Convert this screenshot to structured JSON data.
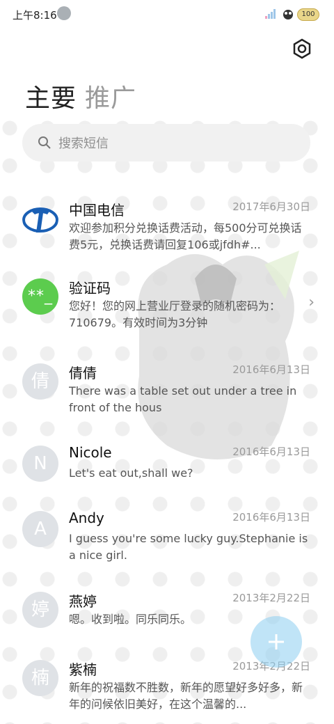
{
  "status_bar": {
    "time": "上午8:16",
    "battery": "100"
  },
  "tabs": [
    {
      "label": "主要",
      "active": true
    },
    {
      "label": "推广",
      "active": false
    }
  ],
  "search": {
    "placeholder": "搜索短信"
  },
  "conversations": [
    {
      "avatar": "telecom-logo",
      "name": "中国电信",
      "date": "2017年6月30日",
      "preview": "欢迎参加积分兑换话费活动，每500分可兑换话费5元，兑换话费请回复106或jfdh#..."
    },
    {
      "avatar_text": "**_",
      "name": "验证码",
      "date": "",
      "preview": "您好！您的网上营业厅登录的随机密码为：710679。有效时间为3分钟"
    },
    {
      "avatar_text": "倩",
      "name": "倩倩",
      "date": "2016年6月13日",
      "preview": "There was a table set out under a tree in front of the hous"
    },
    {
      "avatar_text": "N",
      "name": "Nicole",
      "date": "2016年6月13日",
      "preview": "Let's eat out,shall we?"
    },
    {
      "avatar_text": "A",
      "name": "Andy",
      "date": "2016年6月13日",
      "preview": "I guess you're some lucky guy.Stephanie is a nice girl."
    },
    {
      "avatar_text": "婷",
      "name": "燕婷",
      "date": "2013年2月22日",
      "preview": "嗯。收到啦。同乐同乐。"
    },
    {
      "avatar_text": "楠",
      "name": "紫楠",
      "date": "2013年2月22日",
      "preview": "新年的祝福数不胜数，新年的愿望好多好多，新年的问候依旧美好，在这个温馨的..."
    }
  ],
  "colors": {
    "accent_green": "#5ccc4e",
    "avatar_gray": "#dfe2e6",
    "fab": "#8ccdf0",
    "telecom_blue": "#1a5fb4"
  }
}
